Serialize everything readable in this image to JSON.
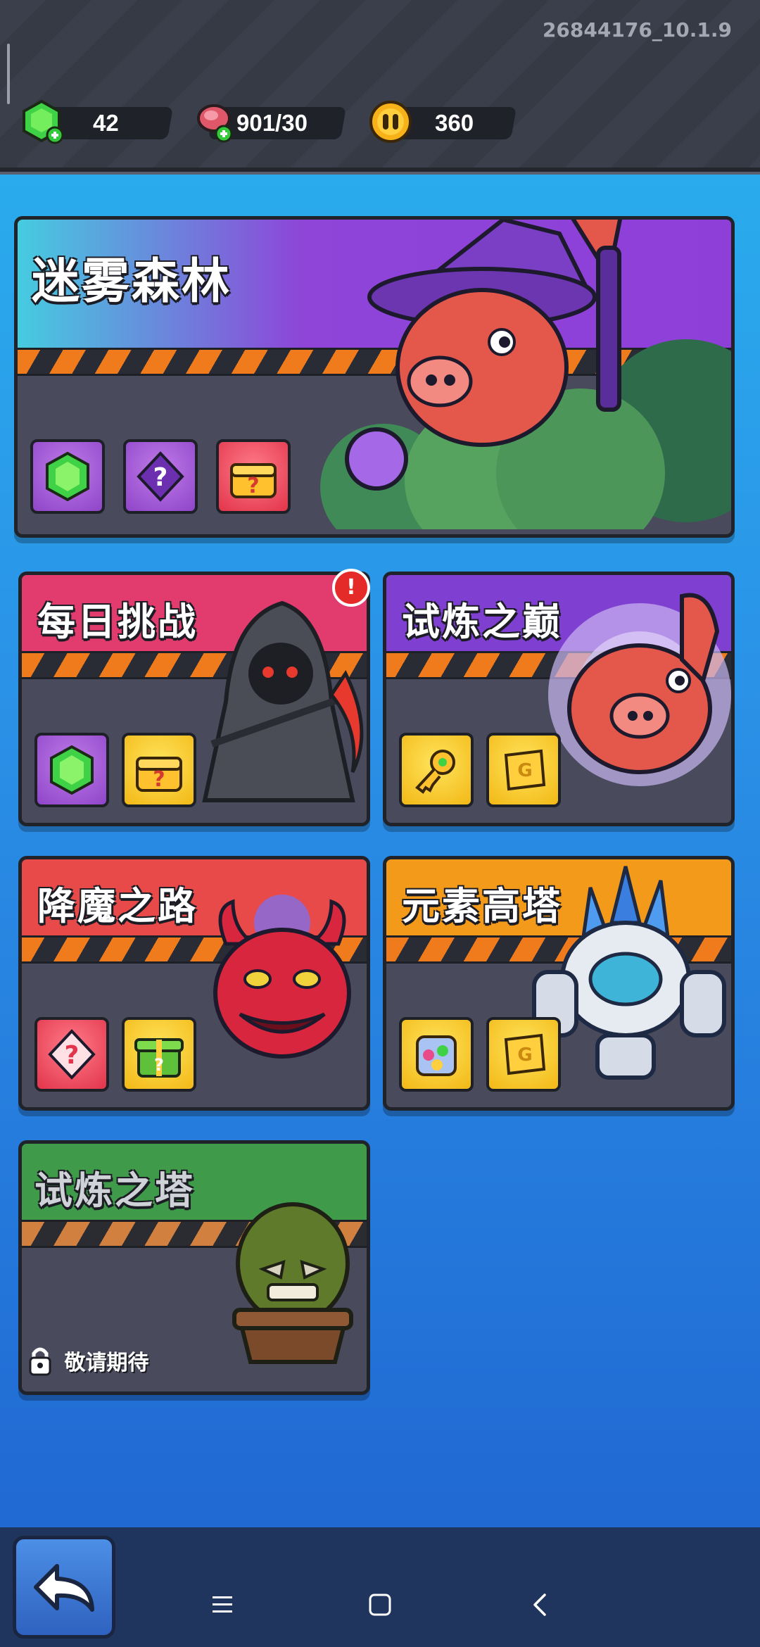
{
  "version": "26844176_10.1.9",
  "resources": {
    "gems": "42",
    "energy": "901/30",
    "coins": "360"
  },
  "cards": {
    "misty_forest": {
      "title": "迷雾森林"
    },
    "daily_challenge": {
      "title": "每日挑战",
      "alert": "!"
    },
    "trial_peak": {
      "title": "试炼之巅"
    },
    "demon_road": {
      "title": "降魔之路"
    },
    "element_tower": {
      "title": "元素高塔"
    },
    "trial_tower": {
      "title": "试炼之塔",
      "locked_label": "敬请期待"
    }
  },
  "colors": {
    "stripe_orange": "#f07b1d",
    "card_body": "#494a5c",
    "misty_head": "#8e45d8",
    "daily_head": "#e23b6e",
    "peak_head": "#7f3fd0",
    "demon_head": "#e84a4a",
    "element_head": "#f39a1a",
    "tower_head": "#3f9a4a"
  },
  "icons": [
    "gem-icon",
    "energy-meat-icon",
    "coin-icon",
    "mystery-card-icon",
    "treasure-chest-icon",
    "key-icon",
    "gold-bar-icon",
    "gift-box-icon",
    "candy-icon",
    "lock-icon",
    "back-arrow-icon"
  ]
}
